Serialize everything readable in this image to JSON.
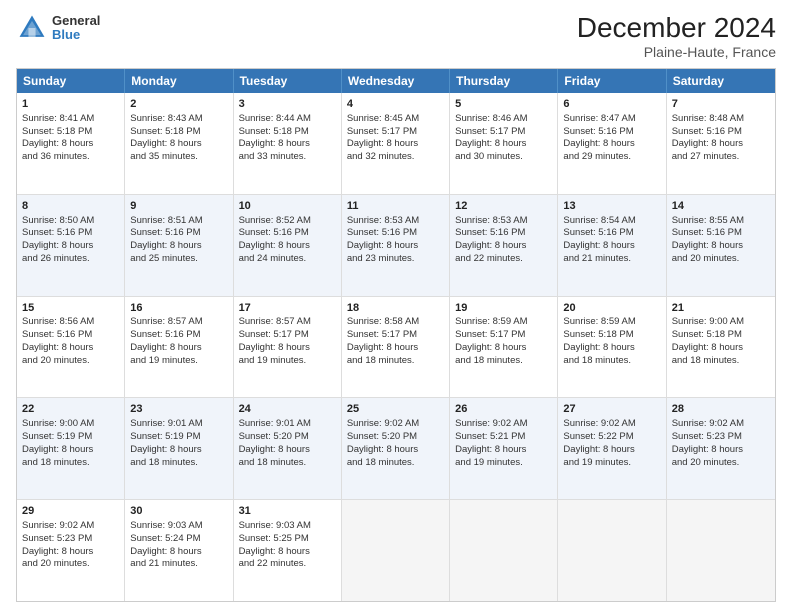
{
  "logo": {
    "general": "General",
    "blue": "Blue"
  },
  "title": "December 2024",
  "subtitle": "Plaine-Haute, France",
  "header_days": [
    "Sunday",
    "Monday",
    "Tuesday",
    "Wednesday",
    "Thursday",
    "Friday",
    "Saturday"
  ],
  "rows": [
    [
      {
        "day": "1",
        "lines": [
          "Sunrise: 8:41 AM",
          "Sunset: 5:18 PM",
          "Daylight: 8 hours",
          "and 36 minutes."
        ]
      },
      {
        "day": "2",
        "lines": [
          "Sunrise: 8:43 AM",
          "Sunset: 5:18 PM",
          "Daylight: 8 hours",
          "and 35 minutes."
        ]
      },
      {
        "day": "3",
        "lines": [
          "Sunrise: 8:44 AM",
          "Sunset: 5:18 PM",
          "Daylight: 8 hours",
          "and 33 minutes."
        ]
      },
      {
        "day": "4",
        "lines": [
          "Sunrise: 8:45 AM",
          "Sunset: 5:17 PM",
          "Daylight: 8 hours",
          "and 32 minutes."
        ]
      },
      {
        "day": "5",
        "lines": [
          "Sunrise: 8:46 AM",
          "Sunset: 5:17 PM",
          "Daylight: 8 hours",
          "and 30 minutes."
        ]
      },
      {
        "day": "6",
        "lines": [
          "Sunrise: 8:47 AM",
          "Sunset: 5:16 PM",
          "Daylight: 8 hours",
          "and 29 minutes."
        ]
      },
      {
        "day": "7",
        "lines": [
          "Sunrise: 8:48 AM",
          "Sunset: 5:16 PM",
          "Daylight: 8 hours",
          "and 27 minutes."
        ]
      }
    ],
    [
      {
        "day": "8",
        "lines": [
          "Sunrise: 8:50 AM",
          "Sunset: 5:16 PM",
          "Daylight: 8 hours",
          "and 26 minutes."
        ]
      },
      {
        "day": "9",
        "lines": [
          "Sunrise: 8:51 AM",
          "Sunset: 5:16 PM",
          "Daylight: 8 hours",
          "and 25 minutes."
        ]
      },
      {
        "day": "10",
        "lines": [
          "Sunrise: 8:52 AM",
          "Sunset: 5:16 PM",
          "Daylight: 8 hours",
          "and 24 minutes."
        ]
      },
      {
        "day": "11",
        "lines": [
          "Sunrise: 8:53 AM",
          "Sunset: 5:16 PM",
          "Daylight: 8 hours",
          "and 23 minutes."
        ]
      },
      {
        "day": "12",
        "lines": [
          "Sunrise: 8:53 AM",
          "Sunset: 5:16 PM",
          "Daylight: 8 hours",
          "and 22 minutes."
        ]
      },
      {
        "day": "13",
        "lines": [
          "Sunrise: 8:54 AM",
          "Sunset: 5:16 PM",
          "Daylight: 8 hours",
          "and 21 minutes."
        ]
      },
      {
        "day": "14",
        "lines": [
          "Sunrise: 8:55 AM",
          "Sunset: 5:16 PM",
          "Daylight: 8 hours",
          "and 20 minutes."
        ]
      }
    ],
    [
      {
        "day": "15",
        "lines": [
          "Sunrise: 8:56 AM",
          "Sunset: 5:16 PM",
          "Daylight: 8 hours",
          "and 20 minutes."
        ]
      },
      {
        "day": "16",
        "lines": [
          "Sunrise: 8:57 AM",
          "Sunset: 5:16 PM",
          "Daylight: 8 hours",
          "and 19 minutes."
        ]
      },
      {
        "day": "17",
        "lines": [
          "Sunrise: 8:57 AM",
          "Sunset: 5:17 PM",
          "Daylight: 8 hours",
          "and 19 minutes."
        ]
      },
      {
        "day": "18",
        "lines": [
          "Sunrise: 8:58 AM",
          "Sunset: 5:17 PM",
          "Daylight: 8 hours",
          "and 18 minutes."
        ]
      },
      {
        "day": "19",
        "lines": [
          "Sunrise: 8:59 AM",
          "Sunset: 5:17 PM",
          "Daylight: 8 hours",
          "and 18 minutes."
        ]
      },
      {
        "day": "20",
        "lines": [
          "Sunrise: 8:59 AM",
          "Sunset: 5:18 PM",
          "Daylight: 8 hours",
          "and 18 minutes."
        ]
      },
      {
        "day": "21",
        "lines": [
          "Sunrise: 9:00 AM",
          "Sunset: 5:18 PM",
          "Daylight: 8 hours",
          "and 18 minutes."
        ]
      }
    ],
    [
      {
        "day": "22",
        "lines": [
          "Sunrise: 9:00 AM",
          "Sunset: 5:19 PM",
          "Daylight: 8 hours",
          "and 18 minutes."
        ]
      },
      {
        "day": "23",
        "lines": [
          "Sunrise: 9:01 AM",
          "Sunset: 5:19 PM",
          "Daylight: 8 hours",
          "and 18 minutes."
        ]
      },
      {
        "day": "24",
        "lines": [
          "Sunrise: 9:01 AM",
          "Sunset: 5:20 PM",
          "Daylight: 8 hours",
          "and 18 minutes."
        ]
      },
      {
        "day": "25",
        "lines": [
          "Sunrise: 9:02 AM",
          "Sunset: 5:20 PM",
          "Daylight: 8 hours",
          "and 18 minutes."
        ]
      },
      {
        "day": "26",
        "lines": [
          "Sunrise: 9:02 AM",
          "Sunset: 5:21 PM",
          "Daylight: 8 hours",
          "and 19 minutes."
        ]
      },
      {
        "day": "27",
        "lines": [
          "Sunrise: 9:02 AM",
          "Sunset: 5:22 PM",
          "Daylight: 8 hours",
          "and 19 minutes."
        ]
      },
      {
        "day": "28",
        "lines": [
          "Sunrise: 9:02 AM",
          "Sunset: 5:23 PM",
          "Daylight: 8 hours",
          "and 20 minutes."
        ]
      }
    ],
    [
      {
        "day": "29",
        "lines": [
          "Sunrise: 9:02 AM",
          "Sunset: 5:23 PM",
          "Daylight: 8 hours",
          "and 20 minutes."
        ]
      },
      {
        "day": "30",
        "lines": [
          "Sunrise: 9:03 AM",
          "Sunset: 5:24 PM",
          "Daylight: 8 hours",
          "and 21 minutes."
        ]
      },
      {
        "day": "31",
        "lines": [
          "Sunrise: 9:03 AM",
          "Sunset: 5:25 PM",
          "Daylight: 8 hours",
          "and 22 minutes."
        ]
      },
      {
        "day": "",
        "lines": []
      },
      {
        "day": "",
        "lines": []
      },
      {
        "day": "",
        "lines": []
      },
      {
        "day": "",
        "lines": []
      }
    ]
  ]
}
